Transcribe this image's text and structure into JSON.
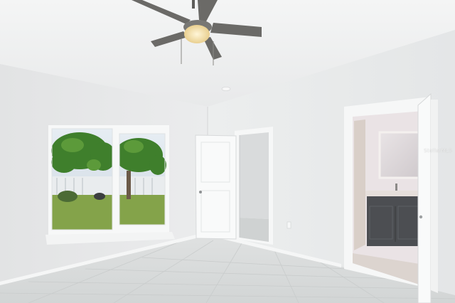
{
  "scene": {
    "subject": "empty-bedroom-interior",
    "colors": {
      "ceiling": "#f1f2f2",
      "left_wall": "#e6e7e8",
      "right_wall": "#eeefef",
      "floor": "#d9dcdc",
      "trim": "#f7f8f8",
      "fan_blade": "#6b6a67",
      "fan_light": "#f6e3b0",
      "vanity": "#4c4e52",
      "foliage": "#3f7f2c",
      "lawn": "#8aa84e",
      "sky": "#dde6ee"
    },
    "icons": {
      "fan": "ceiling-fan-icon",
      "outlet": "outlet-icon"
    }
  },
  "watermark": {
    "text": "StellarMLS"
  }
}
